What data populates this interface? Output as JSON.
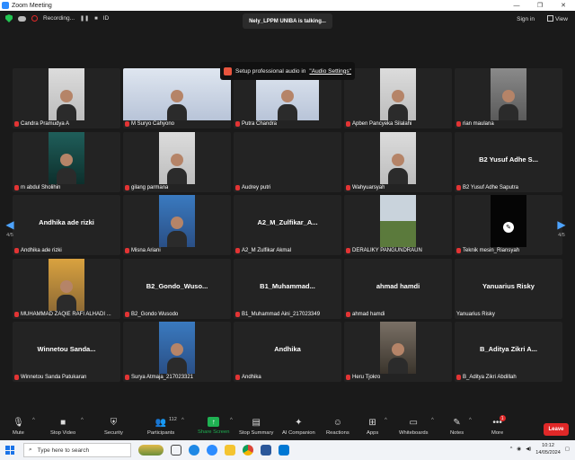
{
  "window": {
    "title": "Zoom Meeting",
    "controls": [
      "—",
      "❐",
      "✕"
    ]
  },
  "topbar": {
    "recording": "Recording...",
    "id_label": "ID",
    "talking": "Nely_LPPM UNIBA is talking...",
    "signin": "Sign in",
    "view": "View"
  },
  "banner": {
    "prefix": "Setup professional audio in",
    "link": "\"Audio Settings\""
  },
  "pagination": {
    "left": "4/5",
    "right": "4/5"
  },
  "tiles": [
    {
      "name": "Candra Pramudya A",
      "big": "",
      "video": "light"
    },
    {
      "name": "M Suryo Cahyono",
      "big": "",
      "video": "banner"
    },
    {
      "name": "Putra Chandra",
      "big": "",
      "video": "banner"
    },
    {
      "name": "Apben Pancyeka Silalahi",
      "big": "",
      "video": "light"
    },
    {
      "name": "rian maulana",
      "big": "",
      "video": "dark"
    },
    {
      "name": "m abdul Sholihin",
      "big": "",
      "video": "green"
    },
    {
      "name": "gilang parmana",
      "big": "",
      "video": "light"
    },
    {
      "name": "Audrey putri",
      "big": "",
      "video": "none"
    },
    {
      "name": "Wahyuarsyah",
      "big": "",
      "video": "light"
    },
    {
      "name": "B2 Yusuf Adhe Saputra",
      "big": "B2 Yusuf Adhe S...",
      "video": "none"
    },
    {
      "name": "Andhika ade rizki",
      "big": "Andhika ade rizki",
      "video": "none"
    },
    {
      "name": "Misna Ariani",
      "big": "",
      "video": "blue"
    },
    {
      "name": "A2_M Zulfikar Akmal",
      "big": "A2_M_Zulfikar_A...",
      "video": "none"
    },
    {
      "name": "DERALIKY PANGUNDRAUN",
      "big": "",
      "video": "land"
    },
    {
      "name": "Teknik mesin_Riansyah",
      "big": "",
      "video": "black"
    },
    {
      "name": "MUHAMMAD ZAQIE RAFI ALHADI ...",
      "big": "",
      "video": "orange"
    },
    {
      "name": "B2_Gondo Wusodo",
      "big": "B2_Gondo_Wuso...",
      "video": "none"
    },
    {
      "name": "B1_Muhammad Aini_217023349",
      "big": "B1_Muhammad...",
      "video": "none"
    },
    {
      "name": "ahmad hamdi",
      "big": "ahmad hamdi",
      "video": "none"
    },
    {
      "name": "Yanuarius Risky",
      "big": "Yanuarius Risky",
      "video": "none"
    },
    {
      "name": "Winnetou Sanda Patukaran",
      "big": "Winnetou Sanda...",
      "video": "none"
    },
    {
      "name": "Surya Atmaja_217023321",
      "big": "",
      "video": "blue"
    },
    {
      "name": "Andhika",
      "big": "Andhika",
      "video": "none"
    },
    {
      "name": "Heru Tjokro",
      "big": "",
      "video": "room"
    },
    {
      "name": "B_Aditya Zikri Abdillah",
      "big": "B_Aditya Zikri A...",
      "video": "none"
    }
  ],
  "toolbar": {
    "mute": "Mute",
    "stop_video": "Stop Video",
    "security": "Security",
    "participants": "Participants",
    "participants_count": "112",
    "share_screen": "Share Screen",
    "stop_summary": "Stop Summary",
    "ai_companion": "AI Companion",
    "reactions": "Reactions",
    "apps": "Apps",
    "whiteboards": "Whiteboards",
    "notes": "Notes",
    "more": "More",
    "more_badge": "1",
    "leave": "Leave"
  },
  "taskbar": {
    "search_placeholder": "Type here to search",
    "time": "10:12",
    "date": "14/05/2024"
  },
  "colors": {
    "accent": "#2d8cff",
    "share": "#1fb152",
    "leave": "#e02828"
  }
}
